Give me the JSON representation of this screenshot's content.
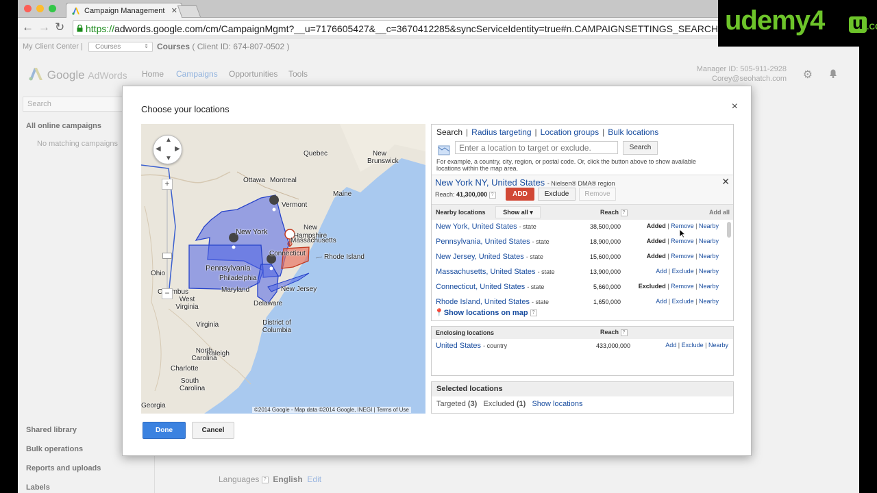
{
  "browser": {
    "tab_title": "Campaign Management",
    "url_scheme": "https://",
    "url_rest": "adwords.google.com/cm/CampaignMgmt?__u=7176605427&__c=3670412285&syncServiceIdentity=true#n.CAMPAIGNSETTINGS_SEARCH-ONLY_AD"
  },
  "account_bar": {
    "mcc_label": "My Client Center",
    "separator": "|",
    "account_select": "Courses",
    "account_name": "Courses",
    "client_id": "( Client ID: 674-807-0502 )"
  },
  "header": {
    "logo_google": "Google",
    "logo_product": "AdWords",
    "nav": [
      "Home",
      "Campaigns",
      "Opportunities",
      "Tools"
    ],
    "manager_id": "Manager ID: 505-911-2928",
    "email": "Corey@seohatch.com"
  },
  "sidebar": {
    "search_placeholder": "Search",
    "all_campaigns": "All online campaigns",
    "no_match": "No matching campaigns",
    "bottom_items": [
      "Shared library",
      "Bulk operations",
      "Reports and uploads",
      "Labels"
    ]
  },
  "page_bottom": {
    "languages_label": "Languages",
    "languages_value": "English",
    "edit_link": "Edit"
  },
  "modal": {
    "title": "Choose your locations",
    "close": "×",
    "done": "Done",
    "cancel": "Cancel",
    "map": {
      "labels": [
        "Quebec",
        "New Brunswick",
        "Ottawa",
        "Montreal",
        "Vermont",
        "Maine",
        "New York",
        "New Hampshire",
        "Massachusetts",
        "Connecticut",
        "Rhode Island",
        "Pennsylvania",
        "Philadelphia",
        "Ohio",
        "Columbus",
        "Maryland",
        "New Jersey",
        "West Virginia",
        "Virginia",
        "Delaware",
        "District of Columbia",
        "North Carolina",
        "Raleigh",
        "Charlotte",
        "South Carolina",
        "Georgia"
      ],
      "copyright": "©2014 Google - Map data ©2014 Google, INEGI",
      "terms": "Terms of Use"
    },
    "panel": {
      "tabs": [
        "Search",
        "Radius targeting",
        "Location groups",
        "Bulk locations"
      ],
      "input_placeholder": "Enter a location to target or exclude.",
      "search_button": "Search",
      "hint": "For example, a country, city, region, or postal code. Or, click the button above to show available locations within the map area.",
      "selected": {
        "name": "New York NY, United States",
        "type": "- Nielsen® DMA® region",
        "reach_label": "Reach:",
        "reach_value": "41,300,000",
        "add": "ADD",
        "exclude": "Exclude",
        "remove": "Remove"
      },
      "nearby_header": "Nearby locations",
      "show_all": "Show all",
      "reach_header": "Reach",
      "add_all": "Add all",
      "nearby": [
        {
          "name": "New York, United States",
          "type": "- state",
          "reach": "38,500,000",
          "status": "Added",
          "a1": "Remove",
          "a2": "Nearby"
        },
        {
          "name": "Pennsylvania, United States",
          "type": "- state",
          "reach": "18,900,000",
          "status": "Added",
          "a1": "Remove",
          "a2": "Nearby"
        },
        {
          "name": "New Jersey, United States",
          "type": "- state",
          "reach": "15,600,000",
          "status": "Added",
          "a1": "Remove",
          "a2": "Nearby"
        },
        {
          "name": "Massachusetts, United States",
          "type": "- state",
          "reach": "13,900,000",
          "status": "Add",
          "a1": "Exclude",
          "a2": "Nearby"
        },
        {
          "name": "Connecticut, United States",
          "type": "- state",
          "reach": "5,660,000",
          "status": "Excluded",
          "a1": "Remove",
          "a2": "Nearby"
        },
        {
          "name": "Rhode Island, United States",
          "type": "- state",
          "reach": "1,650,000",
          "status": "Add",
          "a1": "Exclude",
          "a2": "Nearby"
        }
      ],
      "show_on_map": "Show locations on map",
      "enclosing_header": "Enclosing locations",
      "enclosing": [
        {
          "name": "United States",
          "type": "- country",
          "reach": "433,000,000",
          "a0": "Add",
          "a1": "Exclude",
          "a2": "Nearby"
        }
      ],
      "selected_locations": "Selected locations",
      "targeted_label": "Targeted",
      "targeted_count": "(3)",
      "excluded_label": "Excluded",
      "excluded_count": "(1)",
      "show_locations": "Show locations"
    }
  },
  "watermark": {
    "brand": "udemy",
    "digit": "4",
    "letter": "u",
    "suffix": ".COM"
  },
  "colors": {
    "link": "#1a4ea0",
    "add_red": "#d14836",
    "done_blue": "#3b82e0",
    "targeted_fill": "#5b6fe6",
    "excluded_fill": "#e87966",
    "brand_green": "#6dc42a"
  }
}
